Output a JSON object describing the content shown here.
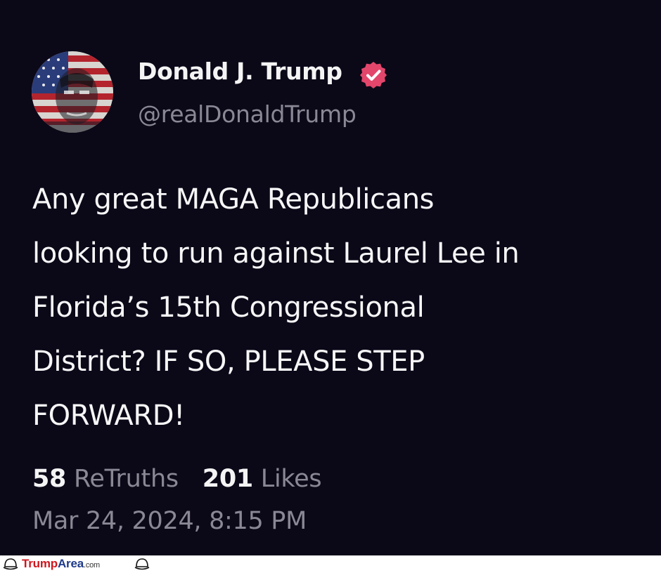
{
  "post": {
    "author_name": "Donald J. Trump",
    "author_handle": "@realDonaldTrump",
    "verified": true,
    "body_lines": [
      "Any great MAGA Republicans",
      "looking to run against Laurel Lee in",
      "Florida’s 15th Congressional",
      "District? IF SO, PLEASE STEP",
      "FORWARD!"
    ],
    "stats": {
      "retruths_count": "58",
      "retruths_label": "ReTruths",
      "likes_count": "201",
      "likes_label": "Likes"
    },
    "timestamp": "Mar 24, 2024, 8:15 PM"
  },
  "watermark": {
    "part1": "Trump",
    "part2": "Area",
    "part3": ".com"
  },
  "colors": {
    "background": "#0b0818",
    "text": "#f4f4f4",
    "muted": "#8a8894",
    "badge": "#e3466b",
    "watermark_red": "#d0161d",
    "watermark_blue": "#1e3a8a"
  },
  "icons": {
    "verified": "verified-badge-icon",
    "avatar": "flag-portrait-avatar",
    "watermark": "hat-icon"
  }
}
